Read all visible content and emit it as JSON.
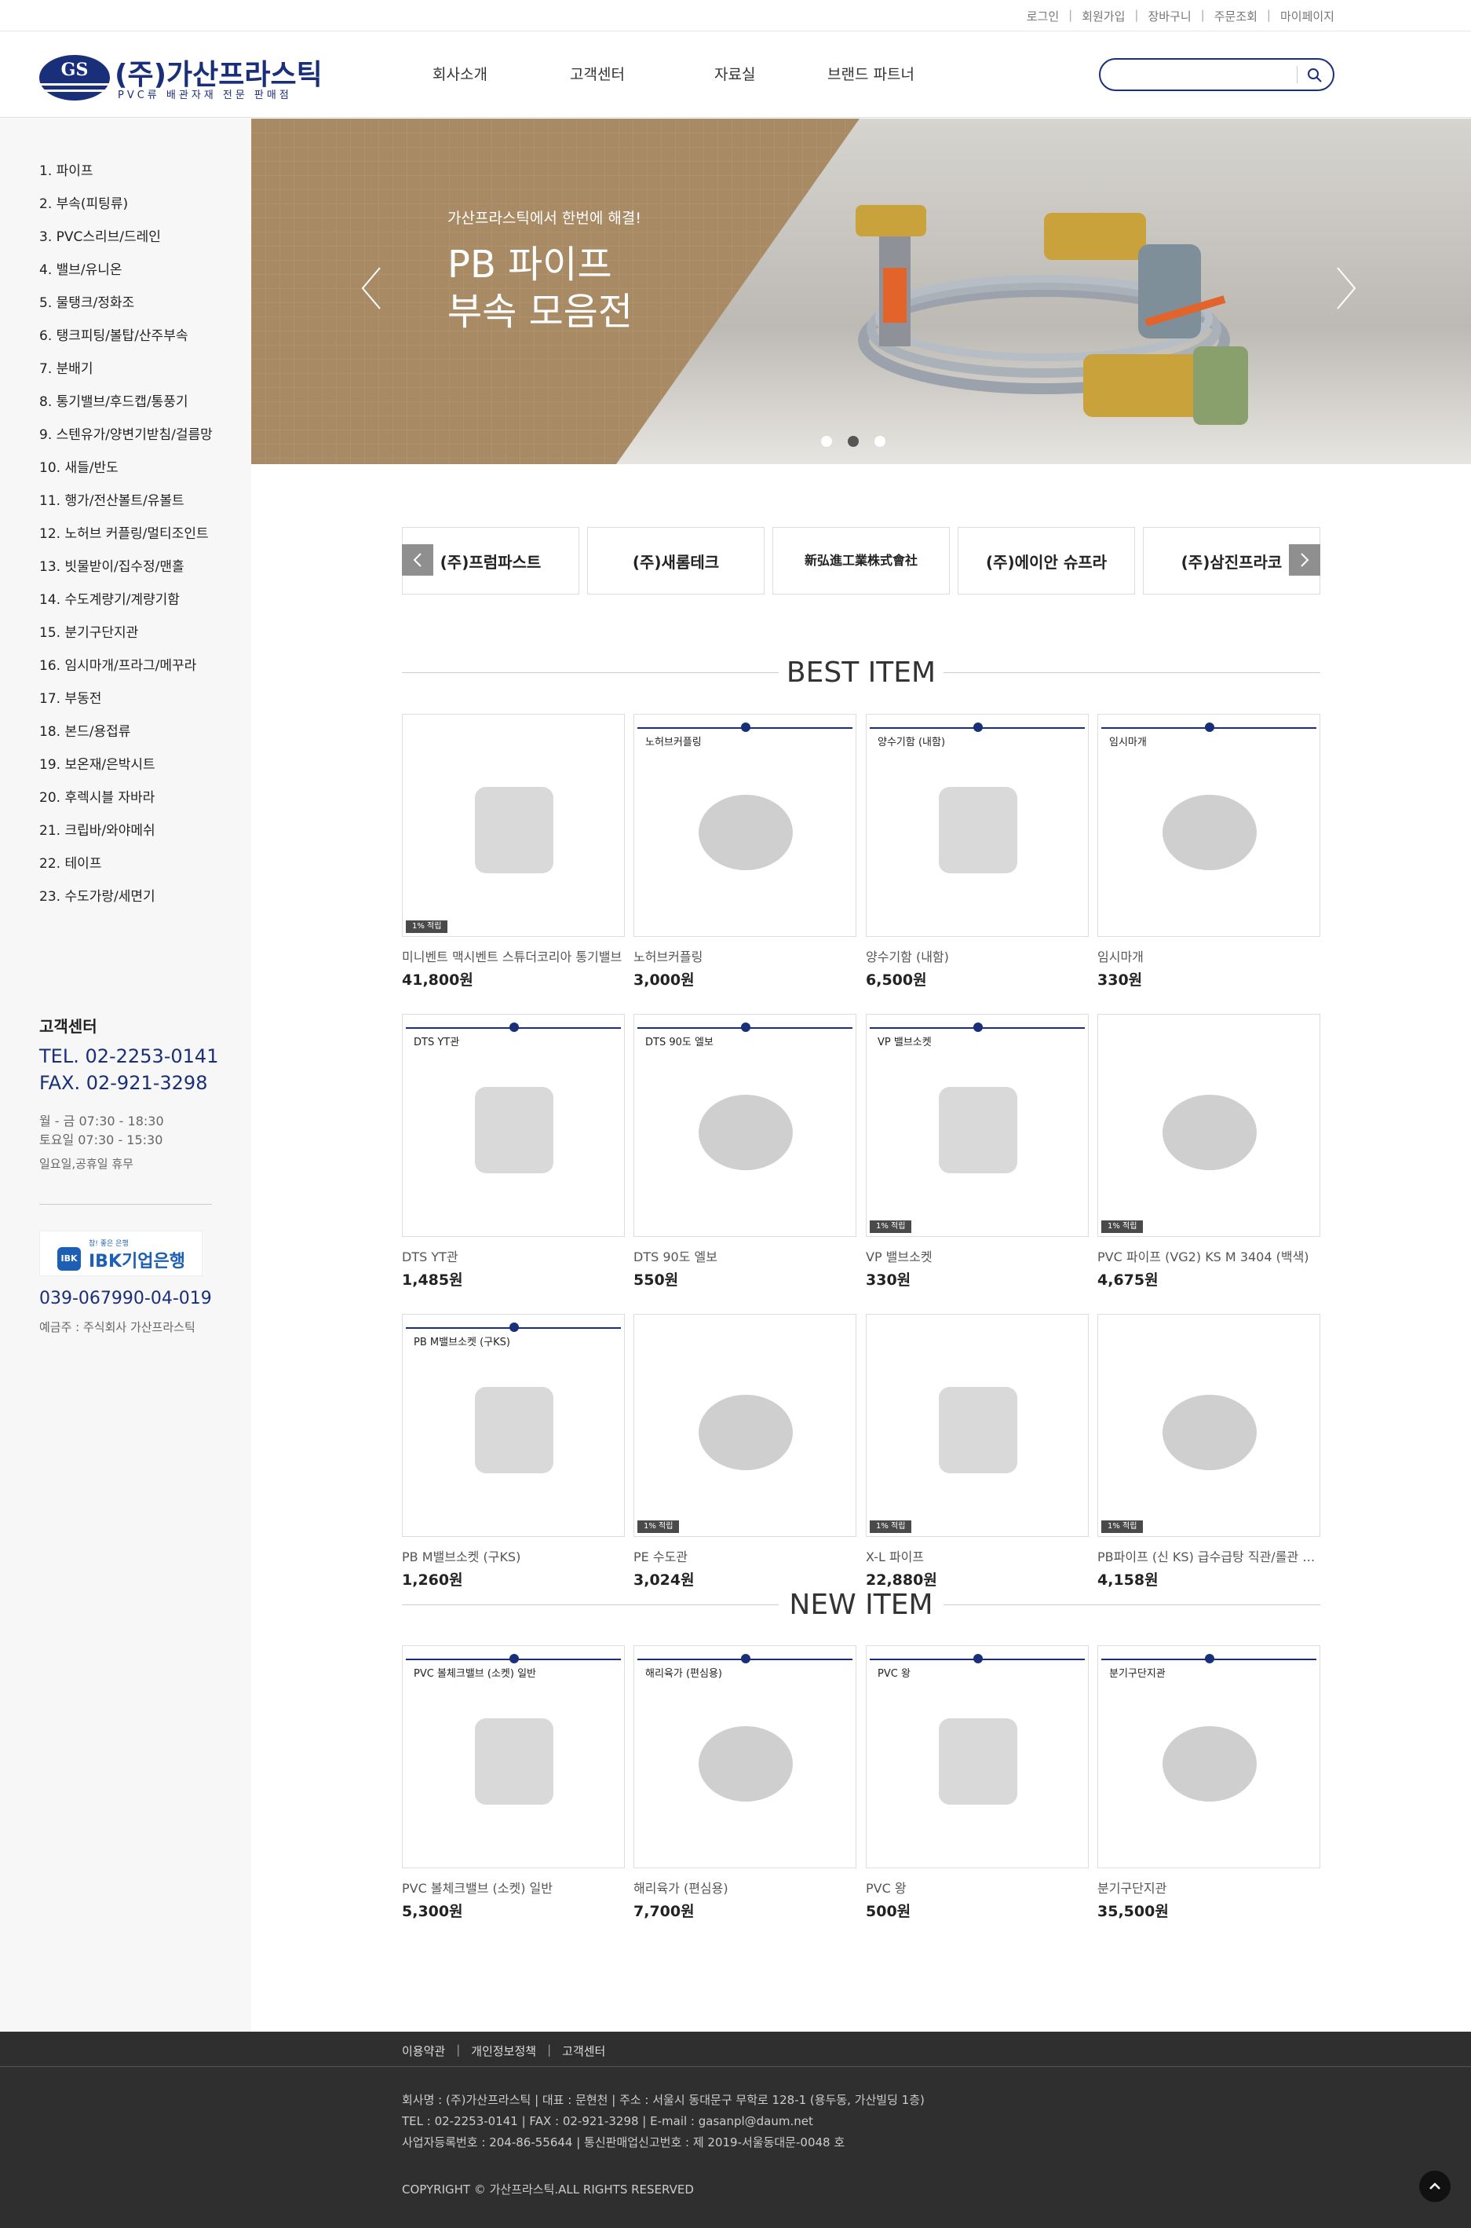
{
  "topbar": {
    "links": [
      "로그인",
      "회원가입",
      "장바구니",
      "주문조회",
      "마이페이지"
    ]
  },
  "header": {
    "logo_mark": "GS",
    "logo_name": "(주)가산프라스틱",
    "logo_sub": "PVC류 배관자재 전문 판매점",
    "nav": [
      "회사소개",
      "고객센터",
      "자료실",
      "브랜드 파트너"
    ],
    "search_placeholder": ""
  },
  "sidebar": {
    "categories": [
      "1. 파이프",
      "2. 부속(피팅류)",
      "3. PVC스리브/드레인",
      "4. 밸브/유니온",
      "5. 물탱크/정화조",
      "6. 탱크피팅/볼탑/산주부속",
      "7. 분배기",
      "8. 통기밸브/후드캡/통풍기",
      "9. 스텐유가/양변기받침/걸름망",
      "10. 새들/반도",
      "11. 행가/전산볼트/유볼트",
      "12. 노허브 커플링/멀티조인트",
      "13. 빗물받이/집수정/맨홀",
      "14. 수도계량기/계량기함",
      "15. 분기구단지관",
      "16. 임시마개/프라그/메꾸라",
      "17. 부동전",
      "18. 본드/용접류",
      "19. 보온재/은박시트",
      "20. 후렉시블 자바라",
      "21. 크립바/와야메쉬",
      "22. 테이프",
      "23. 수도가랑/세면기"
    ],
    "cs_title": "고객센터",
    "tel": "TEL. 02-2253-0141",
    "fax": "FAX. 02-921-3298",
    "hours_weekday": "월 - 금 07:30 - 18:30",
    "hours_sat": "토요일 07:30 - 15:30",
    "holiday": "일요일,공휴일 휴무",
    "bank_slogan": "참! 좋은 은행",
    "bank_icon": "IBK",
    "bank_name": "IBK기업은행",
    "account": "039-067990-04-019",
    "holder": "예금주 : 주식회사 가산프라스틱"
  },
  "banner": {
    "sub": "가산프라스틱에서 한번에 해결!",
    "title1": "PB 파이프",
    "title2": "부속 모음전",
    "slides": 3,
    "active_slide": 2
  },
  "brands": [
    "(주)프럼파스트",
    "(주)새롬테크",
    "新弘進工業株式會社",
    "(주)에이안 슈프라",
    "(주)삼진프라코"
  ],
  "best": {
    "title": "BEST ITEM",
    "items": [
      {
        "label": "",
        "name": "미니벤트 맥시벤트 스튜더코리아 통기밸브",
        "price": "41,800원",
        "point": "1% 적립"
      },
      {
        "label": "노허브커플링",
        "name": "노허브커플링",
        "price": "3,000원",
        "point": ""
      },
      {
        "label": "양수기함 (내함)",
        "name": "양수기함 (내함)",
        "price": "6,500원",
        "point": ""
      },
      {
        "label": "임시마개",
        "name": "임시마개",
        "price": "330원",
        "point": ""
      },
      {
        "label": "DTS YT관",
        "name": "DTS YT관",
        "price": "1,485원",
        "point": ""
      },
      {
        "label": "DTS 90도 엘보",
        "name": "DTS 90도 엘보",
        "price": "550원",
        "point": ""
      },
      {
        "label": "VP 밸브소켓",
        "name": "VP 밸브소켓",
        "price": "330원",
        "point": "1% 적립"
      },
      {
        "label": "",
        "name": "PVC 파이프 (VG2) KS M 3404 (백색)",
        "price": "4,675원",
        "point": "1% 적립"
      },
      {
        "label": "PB M밸브소켓 (구KS)",
        "name": "PB M밸브소켓 (구KS)",
        "price": "1,260원",
        "point": ""
      },
      {
        "label": "",
        "name": "PE 수도관",
        "price": "3,024원",
        "point": "1% 적립"
      },
      {
        "label": "",
        "name": "X-L 파이프",
        "price": "22,880원",
        "point": "1% 적립"
      },
      {
        "label": "",
        "name": "PB파이프 (신 KS) 급수급탕 직관/롤관 일반",
        "price": "4,158원",
        "point": "1% 적립"
      }
    ]
  },
  "new": {
    "title": "NEW ITEM",
    "items": [
      {
        "label": "PVC 볼체크밸브 (소켓) 일반",
        "name": "PVC 볼체크밸브 (소켓) 일반",
        "price": "5,300원",
        "point": ""
      },
      {
        "label": "해리육가 (편심용)",
        "name": "해리육가 (편심용)",
        "price": "7,700원",
        "point": ""
      },
      {
        "label": "PVC 왕",
        "name": "PVC 왕",
        "price": "500원",
        "point": ""
      },
      {
        "label": "분기구단지관",
        "name": "분기구단지관",
        "price": "35,500원",
        "point": ""
      }
    ]
  },
  "footer": {
    "links": [
      "이용약관",
      "개인정보정책",
      "고객센터"
    ],
    "line1": "회사명 : (주)가산프라스틱   |   대표 : 문현천   |   주소 : 서울시 동대문구 무학로 128-1 (용두동, 가산빌딩 1층)",
    "line2": "TEL : 02-2253-0141   |   FAX : 02-921-3298   |   E-mail : gasanpl@daum.net",
    "line3": "사업자등록번호 : 204-86-55644   |   통신판매업신고번호 : 제 2019-서울동대문-0048 호",
    "copyright": "COPYRIGHT © 가산프라스틱.ALL RIGHTS RESERVED"
  }
}
